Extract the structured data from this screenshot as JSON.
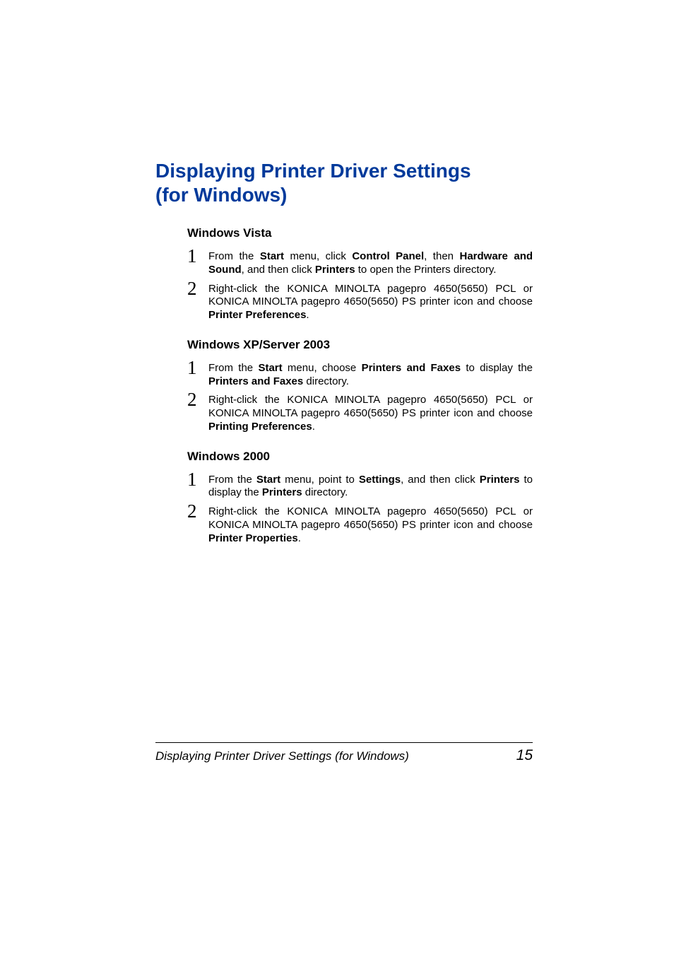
{
  "heading": {
    "line1": "Displaying Printer Driver Settings",
    "line2": "(for Windows)"
  },
  "sections": [
    {
      "title": "Windows Vista",
      "steps": [
        {
          "runs": [
            {
              "t": "From the "
            },
            {
              "t": "Start",
              "b": true
            },
            {
              "t": " menu, click "
            },
            {
              "t": "Control Panel",
              "b": true
            },
            {
              "t": ", then "
            },
            {
              "t": "Hardware and Sound",
              "b": true
            },
            {
              "t": ", and then click "
            },
            {
              "t": "Printers",
              "b": true
            },
            {
              "t": " to open the Printers directory."
            }
          ]
        },
        {
          "runs": [
            {
              "t": "Right-click the KONICA MINOLTA pagepro 4650(5650) PCL or KONICA MINOLTA pagepro 4650(5650) PS printer icon and choose "
            },
            {
              "t": "Printer Preferences",
              "b": true
            },
            {
              "t": "."
            }
          ]
        }
      ]
    },
    {
      "title": "Windows XP/Server 2003",
      "steps": [
        {
          "runs": [
            {
              "t": "From the "
            },
            {
              "t": "Start",
              "b": true
            },
            {
              "t": " menu, choose "
            },
            {
              "t": "Printers and Faxes",
              "b": true
            },
            {
              "t": " to display the "
            },
            {
              "t": "Printers and Faxes",
              "b": true
            },
            {
              "t": " directory."
            }
          ]
        },
        {
          "runs": [
            {
              "t": "Right-click the KONICA MINOLTA pagepro 4650(5650) PCL or KONICA MINOLTA pagepro 4650(5650) PS printer icon and choose "
            },
            {
              "t": "Printing Preferences",
              "b": true
            },
            {
              "t": "."
            }
          ]
        }
      ]
    },
    {
      "title": "Windows 2000",
      "steps": [
        {
          "runs": [
            {
              "t": "From the "
            },
            {
              "t": "Start",
              "b": true
            },
            {
              "t": " menu, point to "
            },
            {
              "t": "Settings",
              "b": true
            },
            {
              "t": ", and then click "
            },
            {
              "t": "Printers",
              "b": true
            },
            {
              "t": " to display the "
            },
            {
              "t": "Printers",
              "b": true
            },
            {
              "t": " directory."
            }
          ]
        },
        {
          "runs": [
            {
              "t": "Right-click the KONICA MINOLTA pagepro 4650(5650) PCL or KONICA MINOLTA pagepro 4650(5650) PS printer icon and choose "
            },
            {
              "t": "Printer Properties",
              "b": true
            },
            {
              "t": "."
            }
          ]
        }
      ]
    }
  ],
  "footer": {
    "title": "Displaying Printer Driver Settings (for Windows)",
    "page": "15"
  }
}
